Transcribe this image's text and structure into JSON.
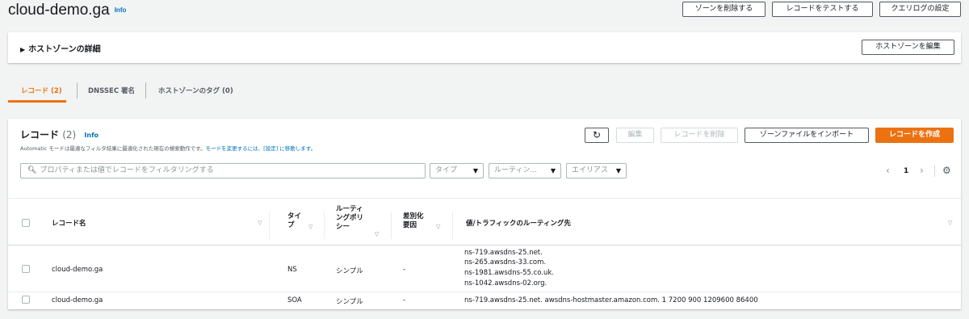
{
  "header": {
    "title": "cloud-demo.ga",
    "info": "Info",
    "buttons": {
      "delete_zone": "ゾーンを削除する",
      "test_record": "レコードをテストする",
      "query_log": "クエリログの設定"
    }
  },
  "zone_details": {
    "label": "ホストゾーンの詳細",
    "edit_button": "ホストゾーンを編集"
  },
  "tabs": [
    {
      "label": "レコード (2)"
    },
    {
      "label": "DNSSEC 署名"
    },
    {
      "label": "ホストゾーンのタグ (0)"
    }
  ],
  "records_panel": {
    "title": "レコード",
    "count": "(2)",
    "info": "Info",
    "desc_prefix": "Automatic モードは最適なフィルタ結果に最適化された現在の検索動作です。",
    "desc_link": "モードを変更するには、[設定] に移動します。",
    "buttons": {
      "edit": "編集",
      "delete": "レコードを削除",
      "import": "ゾーンファイルをインポート",
      "create": "レコードを作成"
    },
    "search_placeholder": "プロパティまたは値でレコードをフィルタリングする",
    "filters": {
      "type": "タイプ",
      "routing": "ルーティン...",
      "alias": "エイリアス"
    },
    "page": "1"
  },
  "table": {
    "headers": {
      "name": "レコード名",
      "type": "タイプ",
      "routing": "ルーティングポリシー",
      "diff": "差別化要因",
      "value": "値/トラフィックのルーティング先"
    },
    "rows": [
      {
        "name": "cloud-demo.ga",
        "type": "NS",
        "routing": "シンプル",
        "diff": "-",
        "values": [
          "ns-719.awsdns-25.net.",
          "ns-265.awsdns-33.com.",
          "ns-1981.awsdns-55.co.uk.",
          "ns-1042.awsdns-02.org."
        ]
      },
      {
        "name": "cloud-demo.ga",
        "type": "SOA",
        "routing": "シンプル",
        "diff": "-",
        "values": [
          "ns-719.awsdns-25.net. awsdns-hostmaster.amazon.com. 1 7200 900 1209600 86400"
        ]
      }
    ]
  }
}
